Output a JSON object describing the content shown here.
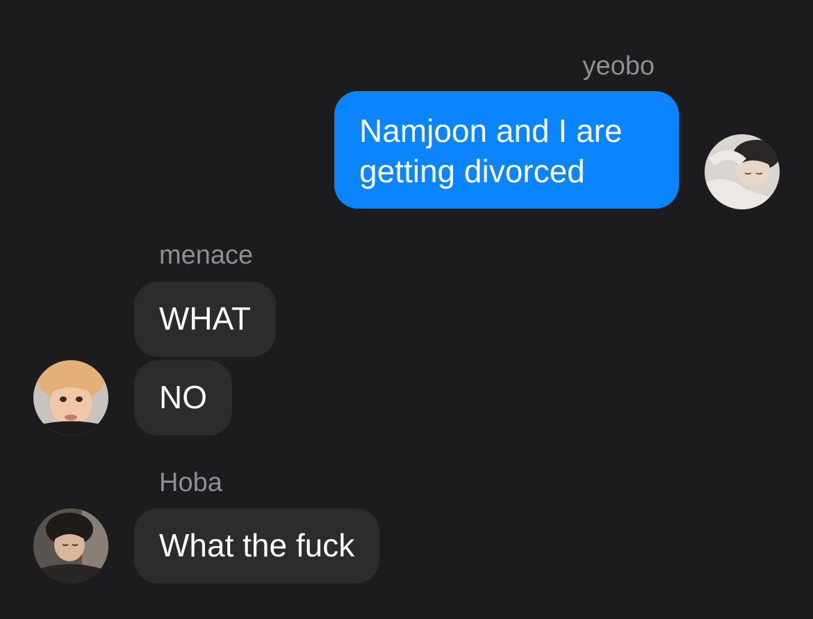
{
  "conversation": {
    "messages": [
      {
        "sender": "yeobo",
        "direction": "outgoing",
        "text": "Namjoon and I are getting divorced",
        "avatar_icon": "person-sleeping-avatar-icon"
      },
      {
        "sender": "menace",
        "direction": "incoming",
        "text": "WHAT"
      },
      {
        "sender": "menace",
        "direction": "incoming",
        "text": "NO",
        "avatar_icon": "person-blonde-avatar-icon"
      },
      {
        "sender": "Hoba",
        "direction": "incoming",
        "text": "What the fuck",
        "avatar_icon": "person-dark-hair-avatar-icon"
      }
    ]
  },
  "colors": {
    "background": "#1c1c1e",
    "incoming_bubble": "#2c2c2e",
    "outgoing_bubble": "#0a84ff",
    "sender_name": "#8e8e93",
    "text": "#ffffff"
  }
}
